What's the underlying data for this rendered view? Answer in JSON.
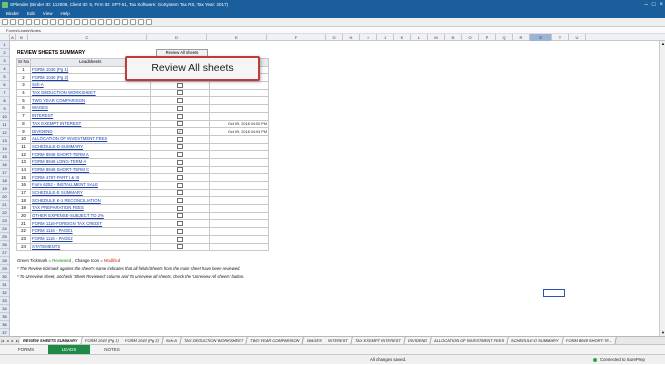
{
  "window": {
    "title": "SPlender (Binder ID: 112008, Client ID: 5, Firm ID: SPT-51, Tax Software: GoSystem Tax RS, Tax Year: 2017)"
  },
  "menu": [
    "Binder",
    "Edit",
    "View",
    "Help"
  ],
  "form_path": "Forms\\Leads\\Notes",
  "columns": [
    "A",
    "B",
    "C",
    "D",
    "E",
    "F",
    "G",
    "H",
    "I",
    "J",
    "K",
    "L",
    "M",
    "N",
    "O",
    "P",
    "Q",
    "R",
    "S",
    "T",
    "U"
  ],
  "selected_column": "S",
  "row_numbers": [
    "1",
    "2",
    "3",
    "4",
    "5",
    "6",
    "7",
    "8",
    "9",
    "10",
    "11",
    "12",
    "13",
    "14",
    "15",
    "16",
    "17",
    "18",
    "19",
    "20",
    "21",
    "22",
    "23",
    "24",
    "25",
    "26",
    "27",
    "28",
    "29",
    "30",
    "31",
    "32",
    "33",
    "34",
    "35",
    "36",
    "37",
    "38"
  ],
  "sheet": {
    "title": "REVIEW SHEETS SUMMARY",
    "review_all_button": "Review All sheets",
    "col_no": "Sr No",
    "col_leadsheets": "Leadsheets",
    "rows": [
      {
        "no": "1",
        "name": "FORM 1040 (Pg 1)",
        "checked": false,
        "date": ""
      },
      {
        "no": "2",
        "name": "FORM 1040 (Pg 2)",
        "checked": false,
        "date": ""
      },
      {
        "no": "3",
        "name": "Sch-A",
        "checked": false,
        "date": ""
      },
      {
        "no": "4",
        "name": "TAX DEDUCTION WORKSHEET",
        "checked": false,
        "date": ""
      },
      {
        "no": "5",
        "name": "TWO YEAR COMPARISON",
        "checked": false,
        "date": ""
      },
      {
        "no": "6",
        "name": "WAGES",
        "checked": false,
        "date": ""
      },
      {
        "no": "7",
        "name": "INTEREST",
        "checked": false,
        "date": ""
      },
      {
        "no": "8",
        "name": "TAX EXEMPT INTEREST",
        "checked": false,
        "date": "Oct 09, 2018 04:00 PM"
      },
      {
        "no": "9",
        "name": "DIVIDEND",
        "checked": true,
        "date": "Oct 09, 2018 04:04 PM"
      },
      {
        "no": "10",
        "name": "ALLOCATION OF INVESTMENT FEES",
        "checked": false,
        "date": ""
      },
      {
        "no": "11",
        "name": "SCHEDULE-D SUMMARY",
        "checked": false,
        "date": ""
      },
      {
        "no": "12",
        "name": "FORM 8949 SHORT-TERM A",
        "checked": false,
        "date": ""
      },
      {
        "no": "13",
        "name": "FORM 8949 LONG-TERM A",
        "checked": false,
        "date": ""
      },
      {
        "no": "14",
        "name": "FORM 8949 SHORT-TERM C",
        "checked": false,
        "date": ""
      },
      {
        "no": "15",
        "name": "FORM 4797-PART I & III",
        "checked": false,
        "date": ""
      },
      {
        "no": "16",
        "name": "Form 6252 - INSTALLMENT SALE",
        "checked": false,
        "date": ""
      },
      {
        "no": "17",
        "name": "SCHEDULE-E SUMMARY",
        "checked": false,
        "date": ""
      },
      {
        "no": "18",
        "name": "SCHEDULE K-1 RECONCILIATION",
        "checked": false,
        "date": ""
      },
      {
        "no": "19",
        "name": "TAX PREPARATION FEES",
        "checked": false,
        "date": ""
      },
      {
        "no": "20",
        "name": "OTHER EXPENSE-SUBJECT TO 2%",
        "checked": false,
        "date": ""
      },
      {
        "no": "21",
        "name": "FORM 1116-FOREIGN TAX CREDIT",
        "checked": false,
        "date": ""
      },
      {
        "no": "22",
        "name": "FORM 1116 - PAGE1",
        "checked": false,
        "date": ""
      },
      {
        "no": "23",
        "name": "FORM 1116 - PAGE2",
        "checked": false,
        "date": ""
      },
      {
        "no": "24",
        "name": "STATEMENTS",
        "checked": false,
        "date": ""
      }
    ],
    "legend_green": "Green Tickmark = ",
    "legend_reviewed": "Reviewed",
    "legend_mid": " , Change Icon = ",
    "legend_modified": "Modified",
    "note1": "* The Review tickmark against the sheet's name indicates that all fields/Sheets from the main sheet have been reviewed.",
    "note2": "* To Unreview sheet, uncheck 'Sheet Reviewed' column and To unreview all sheets, check the 'Unreview All sheets' button."
  },
  "callout": "Review All sheets",
  "sheet_tabs": [
    "REVIEW SHEETS SUMMARY",
    "FORM 1040 (Pg 1)",
    "FORM 1040 (Pg 2)",
    "Sch-A",
    "TAX DEDUCTION WORKSHEET",
    "TWO YEAR COMPARISON",
    "WAGES",
    "INTEREST",
    "TAX EXEMPT INTEREST",
    "DIVIDEND",
    "ALLOCATION OF INVESTMENT FEES",
    "SCHEDULE-D SUMMARY",
    "FORM 8949 SHORT-TE..."
  ],
  "module_tabs": {
    "forms": "FORMS",
    "leads": "LEADS",
    "notes": "NOTES"
  },
  "status": {
    "message": "All changes saved.",
    "connection": "Connected to SurePrep"
  },
  "icons": {
    "checkbox": "checkbox-icon",
    "check": "checkmark-icon"
  },
  "colors": {
    "titlebar": "#1b5e9c",
    "leads_tab": "#1f8a46",
    "callout_border": "#c23b3b",
    "link": "#1a3fb0"
  }
}
